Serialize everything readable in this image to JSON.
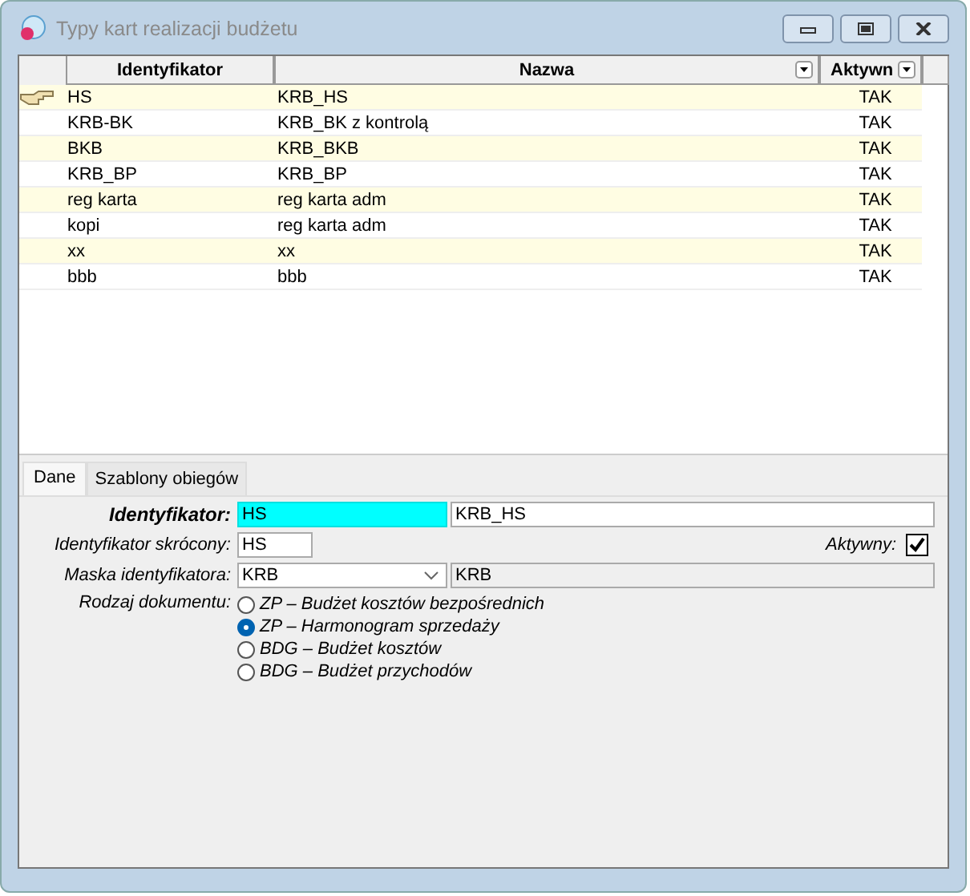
{
  "window": {
    "title": "Typy kart realizacji budżetu"
  },
  "table": {
    "columns": [
      "Identyfikator",
      "Nazwa",
      "Aktywn"
    ],
    "rows": [
      {
        "cells": [
          "HS",
          "KRB_HS",
          "TAK"
        ],
        "selected": true
      },
      {
        "cells": [
          "KRB-BK",
          "KRB_BK z kontrolą",
          "TAK"
        ],
        "selected": false
      },
      {
        "cells": [
          "BKB",
          "KRB_BKB",
          "TAK"
        ],
        "selected": false
      },
      {
        "cells": [
          "KRB_BP",
          "KRB_BP",
          "TAK"
        ],
        "selected": false
      },
      {
        "cells": [
          "reg karta",
          "reg karta adm",
          "TAK"
        ],
        "selected": false
      },
      {
        "cells": [
          "kopi",
          "reg karta adm",
          "TAK"
        ],
        "selected": false
      },
      {
        "cells": [
          "xx",
          "xx",
          "TAK"
        ],
        "selected": false
      },
      {
        "cells": [
          "bbb",
          "bbb",
          "TAK"
        ],
        "selected": false
      }
    ]
  },
  "tabs": [
    {
      "label": "Dane",
      "selected": true
    },
    {
      "label": "Szablony obiegów",
      "selected": false
    }
  ],
  "form": {
    "identyfikator": {
      "label": "Identyfikator:",
      "value": "HS",
      "name": "KRB_HS"
    },
    "skrocony": {
      "label": "Identyfikator skrócony:",
      "value": "HS"
    },
    "aktywny": {
      "label": "Aktywny:",
      "checked": true
    },
    "maska": {
      "label": "Maska identyfikatora:",
      "value": "KRB",
      "preview": "KRB"
    },
    "rodzaj": {
      "label": "Rodzaj dokumentu:",
      "options": [
        {
          "label": "ZP – Budżet kosztów bezpośrednich",
          "selected": false
        },
        {
          "label": "ZP – Harmonogram sprzedaży",
          "selected": true
        },
        {
          "label": "BDG – Budżet kosztów",
          "selected": false
        },
        {
          "label": "BDG – Budżet przychodów",
          "selected": false
        }
      ]
    }
  }
}
